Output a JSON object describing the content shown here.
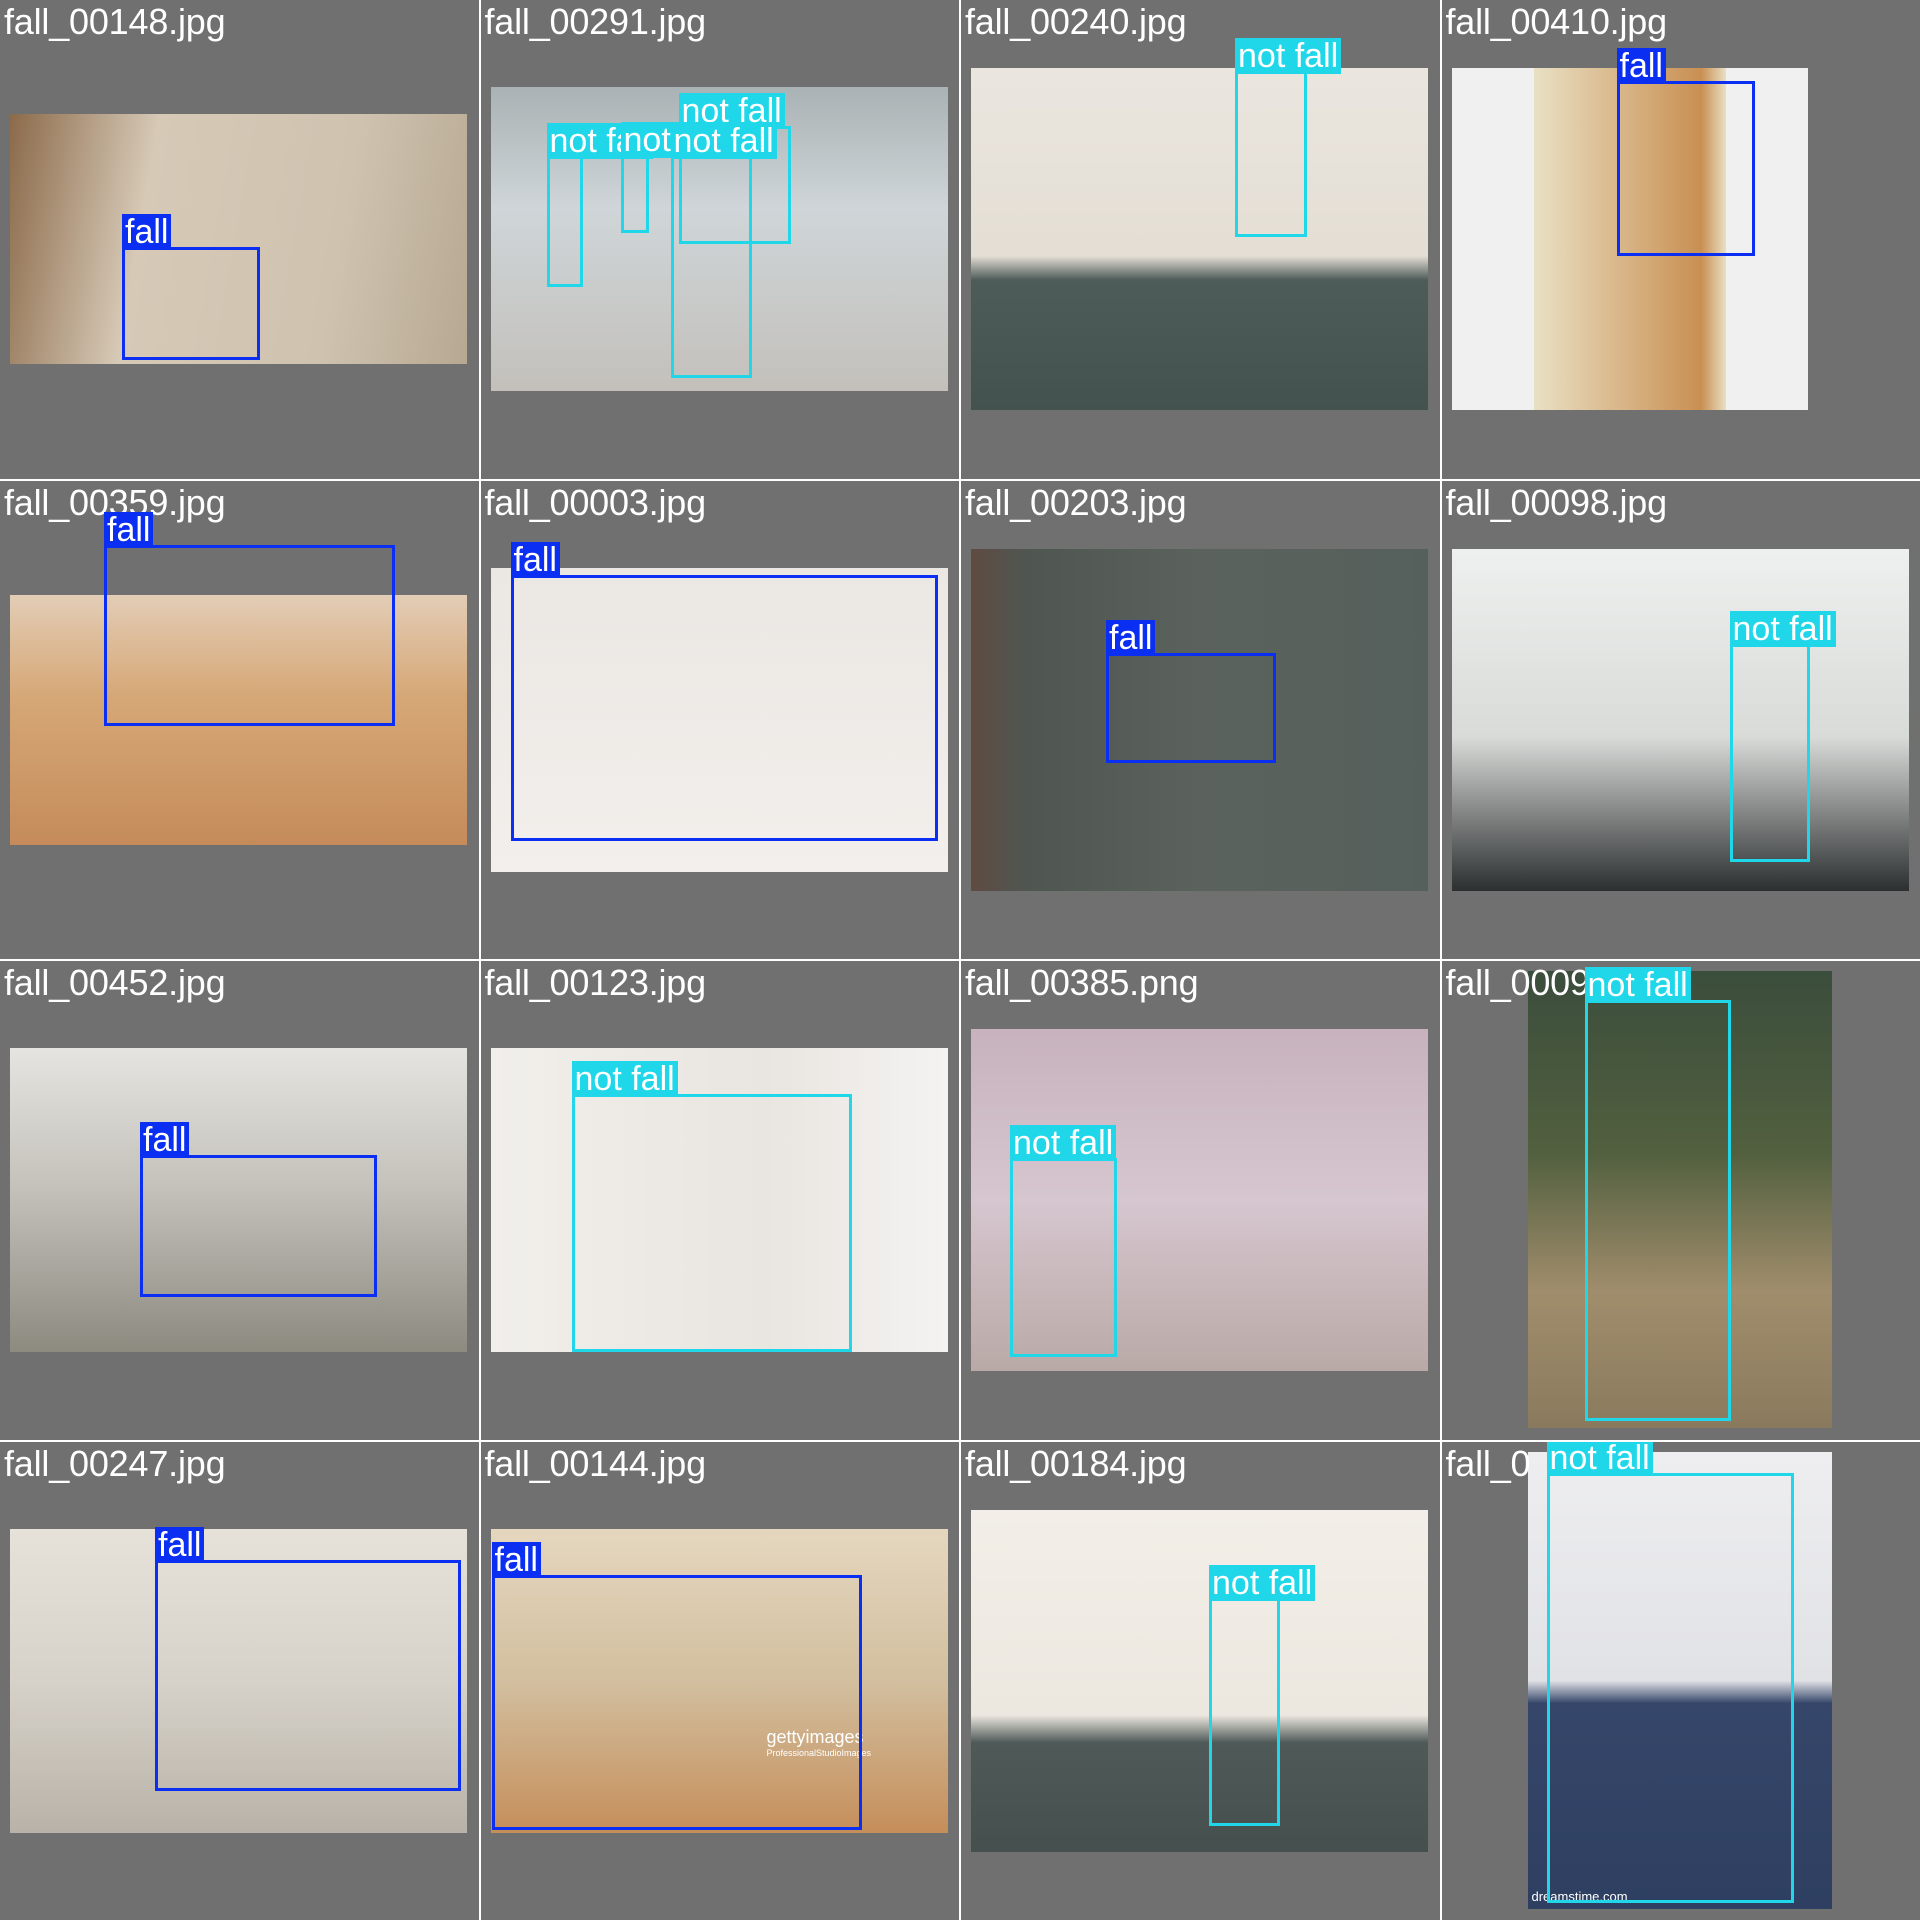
{
  "colors": {
    "fall": "#0b2ff2",
    "not_fall": "#1fd7e8",
    "background": "#707070",
    "grid_line": "#ffffff"
  },
  "tiles": [
    {
      "filename": "fall_00148.jpg",
      "detections": [
        {
          "label": "fall",
          "class": "fall"
        }
      ]
    },
    {
      "filename": "fall_00291.jpg",
      "detections": [
        {
          "label": "not fall",
          "class": "not_fall"
        },
        {
          "label": "not fall",
          "class": "not_fall"
        },
        {
          "label": "not fall",
          "class": "not_fall"
        },
        {
          "label": "not fall",
          "class": "not_fall"
        }
      ]
    },
    {
      "filename": "fall_00240.jpg",
      "detections": [
        {
          "label": "not fall",
          "class": "not_fall"
        }
      ]
    },
    {
      "filename": "fall_00410.jpg",
      "detections": [
        {
          "label": "fall",
          "class": "fall"
        }
      ]
    },
    {
      "filename": "fall_00359.jpg",
      "detections": [
        {
          "label": "fall",
          "class": "fall"
        }
      ]
    },
    {
      "filename": "fall_00003.jpg",
      "detections": [
        {
          "label": "fall",
          "class": "fall"
        }
      ]
    },
    {
      "filename": "fall_00203.jpg",
      "detections": [
        {
          "label": "fall",
          "class": "fall"
        }
      ]
    },
    {
      "filename": "fall_00098.jpg",
      "detections": [
        {
          "label": "not fall",
          "class": "not_fall"
        }
      ]
    },
    {
      "filename": "fall_00452.jpg",
      "detections": [
        {
          "label": "fall",
          "class": "fall"
        }
      ]
    },
    {
      "filename": "fall_00123.jpg",
      "detections": [
        {
          "label": "not fall",
          "class": "not_fall"
        }
      ]
    },
    {
      "filename": "fall_00385.png",
      "detections": [
        {
          "label": "not fall",
          "class": "not_fall"
        }
      ]
    },
    {
      "filename": "fall_0009",
      "detections": [
        {
          "label": "not fall",
          "class": "not_fall"
        }
      ]
    },
    {
      "filename": "fall_00247.jpg",
      "detections": [
        {
          "label": "fall",
          "class": "fall"
        }
      ]
    },
    {
      "filename": "fall_00144.jpg",
      "detections": [
        {
          "label": "fall",
          "class": "fall"
        }
      ]
    },
    {
      "filename": "fall_00184.jpg",
      "detections": [
        {
          "label": "not fall",
          "class": "not_fall"
        }
      ]
    },
    {
      "filename": "fall_0",
      "detections": [
        {
          "label": "not fall",
          "class": "not_fall"
        }
      ]
    }
  ],
  "watermarks": {
    "gettyimages": "gettyimages",
    "getty_sub": "ProfessionalStudioImages",
    "dreamstime": "dreamstime.com"
  }
}
